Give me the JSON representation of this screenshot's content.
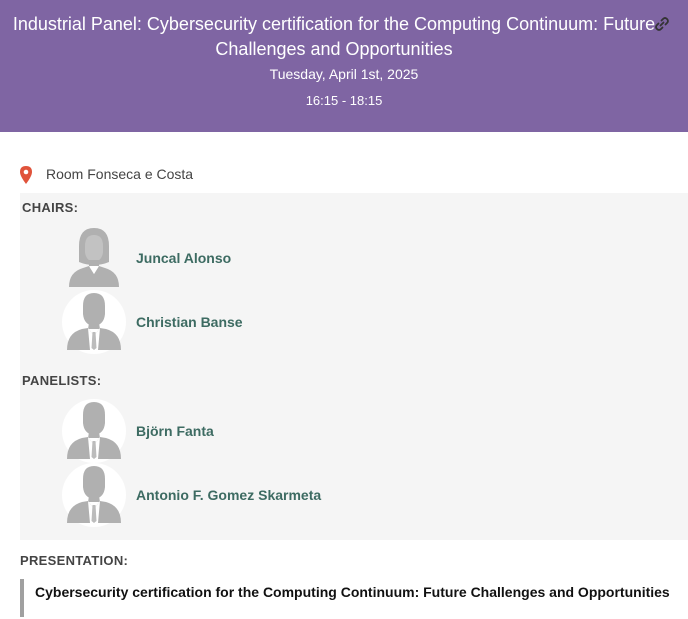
{
  "session": {
    "title": "Industrial Panel: Cybersecurity certification for the Computing Continuum: Future Challenges and Opportunities",
    "date": "Tuesday, April 1st, 2025",
    "time": "16:15 - 18:15",
    "link_icon": "link-icon",
    "header_color": "#7f65a3"
  },
  "location": {
    "icon": "map-pin-icon",
    "room": "Room Fonseca e Costa"
  },
  "chairs": {
    "label": "CHAIRS:",
    "people": [
      {
        "name": "Juncal Alonso",
        "avatar": "female-avatar-icon"
      },
      {
        "name": "Christian Banse",
        "avatar": "male-avatar-icon"
      }
    ]
  },
  "panelists": {
    "label": "PANELISTS:",
    "people": [
      {
        "name": "Björn Fanta",
        "avatar": "male-avatar-icon"
      },
      {
        "name": "Antonio F. Gomez Skarmeta",
        "avatar": "male-avatar-icon"
      }
    ]
  },
  "presentation": {
    "label": "PRESENTATION:",
    "title": "Cybersecurity certification for the Computing Continuum: Future Challenges and Opportunities"
  },
  "colors": {
    "name_text": "#3d6b62",
    "pin": "#e0533b"
  }
}
